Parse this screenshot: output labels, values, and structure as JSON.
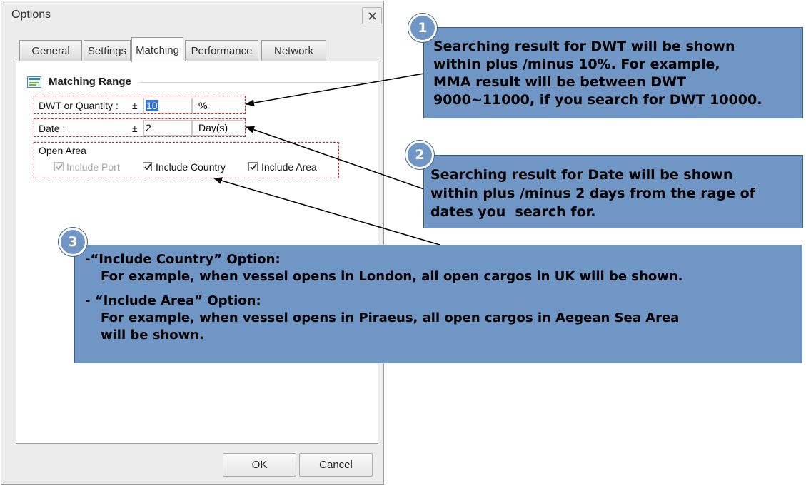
{
  "dialog": {
    "title": "Options",
    "tabs": [
      "General",
      "Settings",
      "Matching",
      "Performance",
      "Network"
    ],
    "active_tab": "Matching"
  },
  "matching_range": {
    "title": "Matching Range",
    "dwt_label": "DWT or Quantity :",
    "dwt_pm": "±",
    "dwt_value": "10",
    "dwt_unit": "%",
    "date_label": "Date :",
    "date_pm": "±",
    "date_value": "2",
    "date_unit": "Day(s)",
    "open_area_label": "Open Area",
    "include_port": "Include Port",
    "include_country": "Include Country",
    "include_area": "Include Area"
  },
  "footer": {
    "ok": "OK",
    "cancel": "Cancel"
  },
  "callouts": {
    "c1": {
      "num": "1",
      "line1": "Searching result for DWT will be shown",
      "line2": "within plus /minus 10%. For example,",
      "line3": "MMA result will be between DWT",
      "line4": "9000~11000, if you search for DWT 10000."
    },
    "c2": {
      "num": "2",
      "line1": "Searching result for Date will be shown",
      "line2": "within plus /minus 2 days from the rage of",
      "line3": "dates you  search for."
    },
    "c3": {
      "num": "3",
      "line1": "-“Include Country” Option:",
      "line2": "For example, when vessel opens in London, all open cargos in UK will be shown.",
      "line3": "- “Include Area” Option:",
      "line4": "For example, when vessel opens in Piraeus, all open cargos in Aegean Sea Area",
      "line5": "will be shown."
    }
  },
  "colors": {
    "callout_fill": "#6f96c4",
    "dashed_highlight": "#e02020"
  }
}
